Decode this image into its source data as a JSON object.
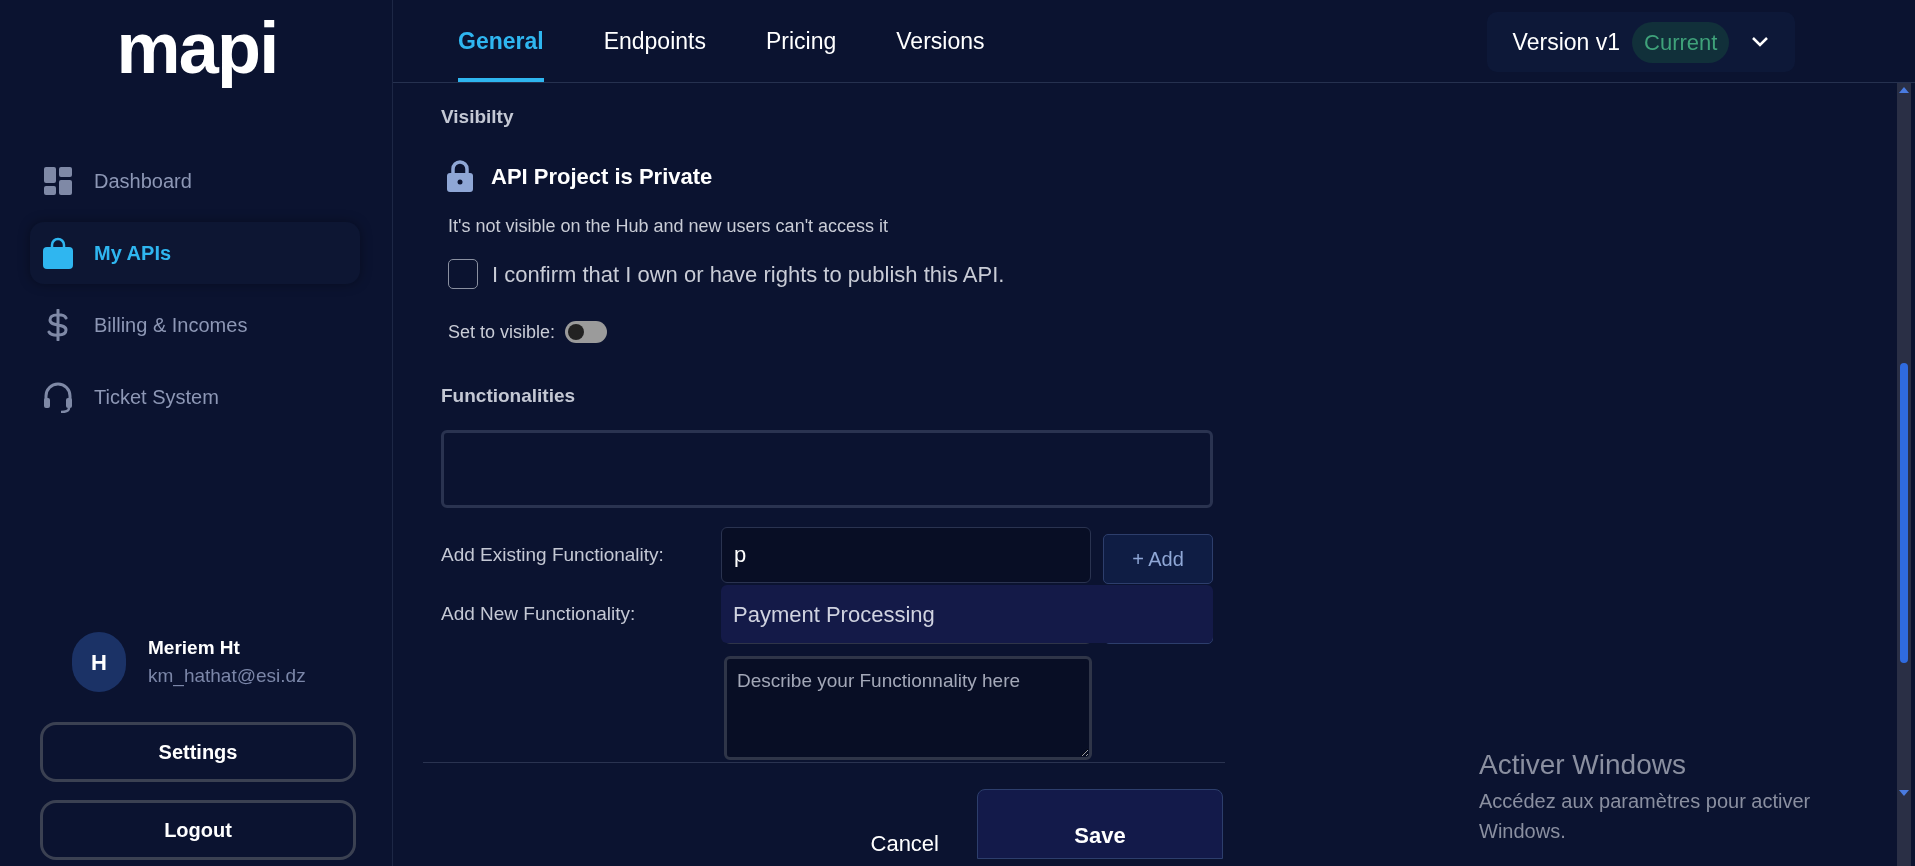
{
  "logo": "mapi",
  "sidebar": {
    "items": [
      {
        "label": "Dashboard",
        "selected": false
      },
      {
        "label": "My APIs",
        "selected": true
      },
      {
        "label": "Billing & Incomes",
        "selected": false
      },
      {
        "label": "Ticket System",
        "selected": false
      }
    ]
  },
  "user": {
    "initial": "H",
    "name": "Meriem Ht",
    "email": "km_hathat@esi.dz"
  },
  "sidebar_buttons": [
    "Settings",
    "Logout"
  ],
  "tabs": [
    {
      "label": "General",
      "selected": true
    },
    {
      "label": "Endpoints",
      "selected": false
    },
    {
      "label": "Pricing",
      "selected": false
    },
    {
      "label": "Versions",
      "selected": false
    }
  ],
  "version": {
    "label": "Version v1",
    "badge": "Current"
  },
  "visibility": {
    "heading": "Visibilty",
    "status": "API Project is Private",
    "description": "It's not visible on the Hub and new users can't access it",
    "confirm": {
      "label": "I confirm that I own or have rights to publish this API.",
      "checked": false
    },
    "toggle": {
      "label": "Set to visible:",
      "on": false
    }
  },
  "functionalities": {
    "heading": "Functionalities",
    "add_existing": {
      "label": "Add Existing Functionality:",
      "value": "p",
      "button": "+ Add",
      "suggestions": [
        "Payment Processing"
      ]
    },
    "add_new": {
      "label": "Add New Functionality:",
      "description_placeholder": "Describe your Functionnality here"
    }
  },
  "actions": [
    "Cancel",
    "Save"
  ],
  "windows_notice": {
    "title": "Activer Windows",
    "text": "Accédez aux paramètres pour activer Windows."
  }
}
